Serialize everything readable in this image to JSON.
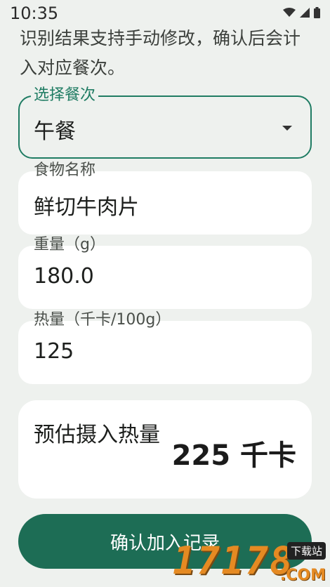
{
  "status_bar": {
    "time": "10:35"
  },
  "description": "识别结果支持手动修改，确认后会计入对应餐次。",
  "meal_select": {
    "label": "选择餐次",
    "value": "午餐"
  },
  "food_name": {
    "label": "食物名称",
    "value": "鲜切牛肉片"
  },
  "weight": {
    "label": "重量（g）",
    "value": "180.0"
  },
  "calories": {
    "label": "热量（千卡/100g）",
    "value": "125"
  },
  "estimate": {
    "label": "预估摄入热量",
    "value": "225 千卡"
  },
  "confirm_button": {
    "label": "确认加入记录"
  },
  "watermark": {
    "number": "17178",
    "tag": "下载站",
    "suffix": ".COM"
  },
  "colors": {
    "accent": "#1f7c63",
    "button": "#1d6d55",
    "background": "#eef1ee"
  }
}
